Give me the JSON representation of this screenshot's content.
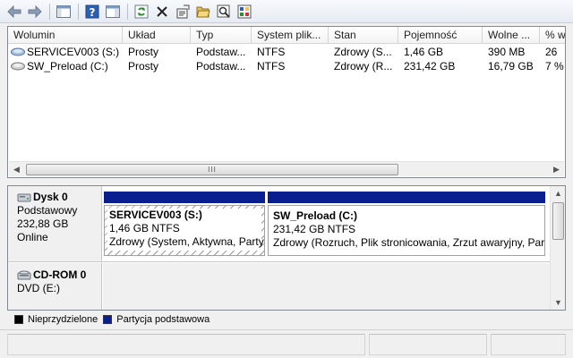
{
  "toolbar": {
    "buttons": [
      "back-icon",
      "forward-icon",
      "console-tree-icon",
      "help-icon",
      "action-pane-icon",
      "refresh-icon",
      "delete-icon",
      "properties-icon",
      "open-icon",
      "explore-icon",
      "help-topic-icon"
    ]
  },
  "volumes": {
    "columns": [
      "Wolumin",
      "Układ",
      "Typ",
      "System plik...",
      "Stan",
      "Pojemność",
      "Wolne ...",
      "% w"
    ],
    "rows": [
      {
        "name": "SERVICEV003 (S:)",
        "layout": "Prosty",
        "type": "Podstaw...",
        "fs": "NTFS",
        "status": "Zdrowy (S...",
        "capacity": "1,46 GB",
        "free": "390 MB",
        "pct": "26"
      },
      {
        "name": "SW_Preload (C:)",
        "layout": "Prosty",
        "type": "Podstaw...",
        "fs": "NTFS",
        "status": "Zdrowy (R...",
        "capacity": "231,42 GB",
        "free": "16,79 GB",
        "pct": "7 %"
      }
    ]
  },
  "disks": [
    {
      "name": "Dysk 0",
      "type": "Podstawowy",
      "size": "232,88 GB",
      "state": "Online",
      "partitions": [
        {
          "title": "SERVICEV003  (S:)",
          "size": "1,46 GB NTFS",
          "status": "Zdrowy (System, Aktywna, Partycja podstawowa)"
        },
        {
          "title": "SW_Preload  (C:)",
          "size": "231,42 GB NTFS",
          "status": "Zdrowy (Rozruch, Plik stronicowania, Zrzut awaryjny, Partycja podstawowa)"
        }
      ]
    },
    {
      "name": "CD-ROM 0",
      "type": "DVD (E:)"
    }
  ],
  "legend": [
    {
      "label": "Nieprzydzielone",
      "color": "#000000"
    },
    {
      "label": "Partycja podstawowa",
      "color": "#0a1f8f"
    }
  ]
}
